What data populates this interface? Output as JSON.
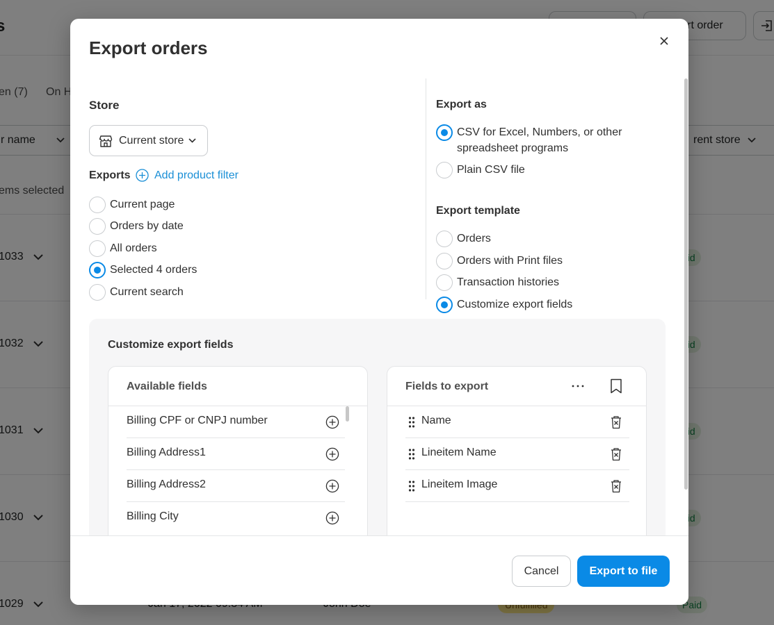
{
  "background": {
    "title_fragment": "s",
    "import_button": "port order",
    "tabs": [
      "en (7)",
      "On H"
    ],
    "filter_left": "r name",
    "filter_right": "rent store",
    "selected_text": "ems selected",
    "rows": [
      {
        "id": "1033",
        "payment": "aid"
      },
      {
        "id": "1032",
        "payment": "aid"
      },
      {
        "id": "1031",
        "payment": "aid"
      },
      {
        "id": "1030",
        "payment": "aid"
      },
      {
        "id": "1029",
        "payment": "Paid",
        "date": "Jan 17, 2022 09:34 AM",
        "customer": "John Doe",
        "fulfillment": "Unfulfilled"
      }
    ]
  },
  "modal": {
    "title": "Export orders",
    "store": {
      "label": "Store",
      "value": "Current store"
    },
    "exports": {
      "label": "Exports",
      "add_filter": "Add product filter",
      "options": [
        {
          "label": "Current page",
          "selected": false
        },
        {
          "label": "Orders by date",
          "selected": false
        },
        {
          "label": "All orders",
          "selected": false
        },
        {
          "label": "Selected 4 orders",
          "selected": true
        },
        {
          "label": "Current search",
          "selected": false
        }
      ]
    },
    "export_as": {
      "label": "Export as",
      "options": [
        {
          "label": "CSV for Excel, Numbers, or other",
          "label2": "spreadsheet programs",
          "selected": true
        },
        {
          "label": "Plain CSV file",
          "selected": false
        }
      ]
    },
    "export_template": {
      "label": "Export template",
      "options": [
        {
          "label": "Orders",
          "selected": false
        },
        {
          "label": "Orders with Print files",
          "selected": false
        },
        {
          "label": "Transaction histories",
          "selected": false
        },
        {
          "label": "Customize export fields",
          "selected": true
        }
      ]
    },
    "customize": {
      "title": "Customize export fields",
      "available": {
        "title": "Available fields",
        "items": [
          "Billing CPF or CNPJ number",
          "Billing Address1",
          "Billing Address2",
          "Billing City"
        ]
      },
      "to_export": {
        "title": "Fields to export",
        "items": [
          "Name",
          "Lineitem Name",
          "Lineitem Image"
        ]
      }
    },
    "footer": {
      "cancel": "Cancel",
      "export": "Export to file"
    }
  },
  "colors": {
    "accent": "#0a8ae6",
    "link": "#1a8fd6",
    "text": "#303030"
  }
}
